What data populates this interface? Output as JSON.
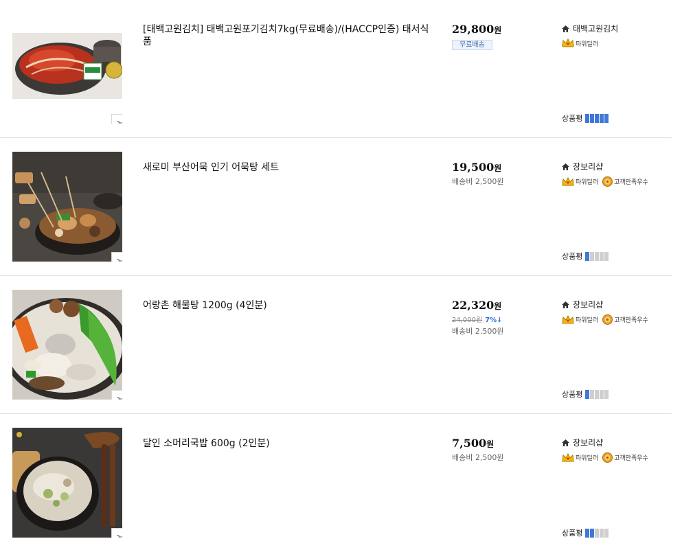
{
  "cart_icon": "cart-icon",
  "products": [
    {
      "title": "[태백고원김치] 태백고원포기김치7kg(무료배송)/(HACCP인증) 태서식품",
      "price": "29,800",
      "won": "원",
      "free_shipping": "무료배송",
      "original_price": "",
      "discount_rate": "",
      "shipping": "",
      "shop": "태백고원김치",
      "badge1": "파워딜러",
      "badge2": "",
      "rating_label": "상품평",
      "rating_score": 5,
      "image": "kimchi"
    },
    {
      "title": "새로미 부산어묵 인기 어묵탕 세트",
      "price": "19,500",
      "won": "원",
      "free_shipping": "",
      "original_price": "",
      "discount_rate": "",
      "shipping": "배송비 2,500원",
      "shop": "장보리샵",
      "badge1": "파워딜러",
      "badge2": "고객만족우수",
      "rating_label": "상품평",
      "rating_score": 1,
      "image": "fishcake"
    },
    {
      "title": "어랑촌 해물탕 1200g (4인분)",
      "price": "22,320",
      "won": "원",
      "free_shipping": "",
      "original_price": "24,000원",
      "discount_rate": "7%↓",
      "shipping": "배송비 2,500원",
      "shop": "장보리샵",
      "badge1": "파워딜러",
      "badge2": "고객만족우수",
      "rating_label": "상품평",
      "rating_score": 1,
      "image": "seafood"
    },
    {
      "title": "달인 소머리국밥 600g (2인분)",
      "price": "7,500",
      "won": "원",
      "free_shipping": "",
      "original_price": "",
      "discount_rate": "",
      "shipping": "배송비 2,500원",
      "shop": "장보리샵",
      "badge1": "파워딜러",
      "badge2": "고객만족우수",
      "rating_label": "상품평",
      "rating_score": 2,
      "image": "gukbap"
    }
  ]
}
